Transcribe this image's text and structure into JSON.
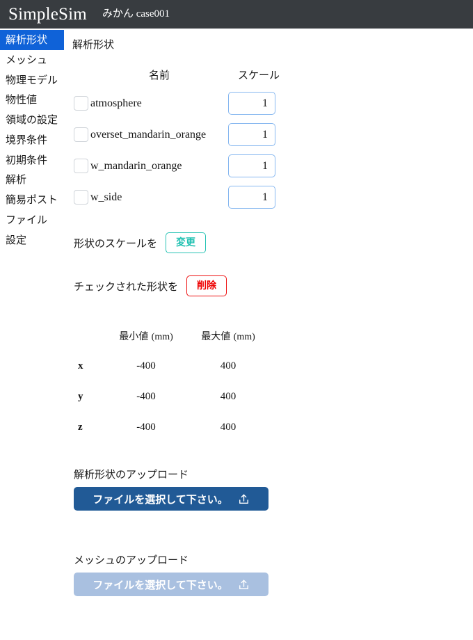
{
  "header": {
    "brand": "SimpleSim",
    "case_label": "みかん case001",
    "background_color": "#383c40"
  },
  "sidebar": {
    "active_color": "#0f62d8",
    "items": [
      {
        "label": "解析形状",
        "active": true
      },
      {
        "label": "メッシュ",
        "active": false
      },
      {
        "label": "物理モデル",
        "active": false
      },
      {
        "label": "物性値",
        "active": false
      },
      {
        "label": "領域の設定",
        "active": false
      },
      {
        "label": "境界条件",
        "active": false
      },
      {
        "label": "初期条件",
        "active": false
      },
      {
        "label": "解析",
        "active": false
      },
      {
        "label": "簡易ポスト",
        "active": false
      },
      {
        "label": "ファイル",
        "active": false
      },
      {
        "label": "設定",
        "active": false
      }
    ]
  },
  "main": {
    "page_title": "解析形状",
    "shapes_table": {
      "headers": {
        "name": "名前",
        "scale": "スケール"
      },
      "rows": [
        {
          "name": "atmosphere",
          "scale": "1",
          "checked": false
        },
        {
          "name": "overset_mandarin_orange",
          "scale": "1",
          "checked": false
        },
        {
          "name": "w_mandarin_orange",
          "scale": "1",
          "checked": false
        },
        {
          "name": "w_side",
          "scale": "1",
          "checked": false
        }
      ]
    },
    "scale_action": {
      "label": "形状のスケールを",
      "button_label": "変更",
      "button_color": "#1fc0b1"
    },
    "delete_action": {
      "label": "チェックされた形状を",
      "button_label": "削除",
      "button_color": "#ee0000"
    },
    "bounds_table": {
      "headers": {
        "min": "最小値",
        "min_unit": "(mm)",
        "max": "最大値",
        "max_unit": "(mm)"
      },
      "rows": [
        {
          "axis": "x",
          "min": "-400",
          "max": "400"
        },
        {
          "axis": "y",
          "min": "-400",
          "max": "400"
        },
        {
          "axis": "z",
          "min": "-400",
          "max": "400"
        }
      ]
    },
    "geometry_upload": {
      "label": "解析形状のアップロード",
      "button_label": "ファイルを選択して下さい。",
      "icon": "upload-icon",
      "button_color": "#215a96"
    },
    "mesh_upload": {
      "label": "メッシュのアップロード",
      "button_label": "ファイルを選択して下さい。",
      "icon": "upload-icon",
      "button_color": "#a9c0e0"
    }
  }
}
